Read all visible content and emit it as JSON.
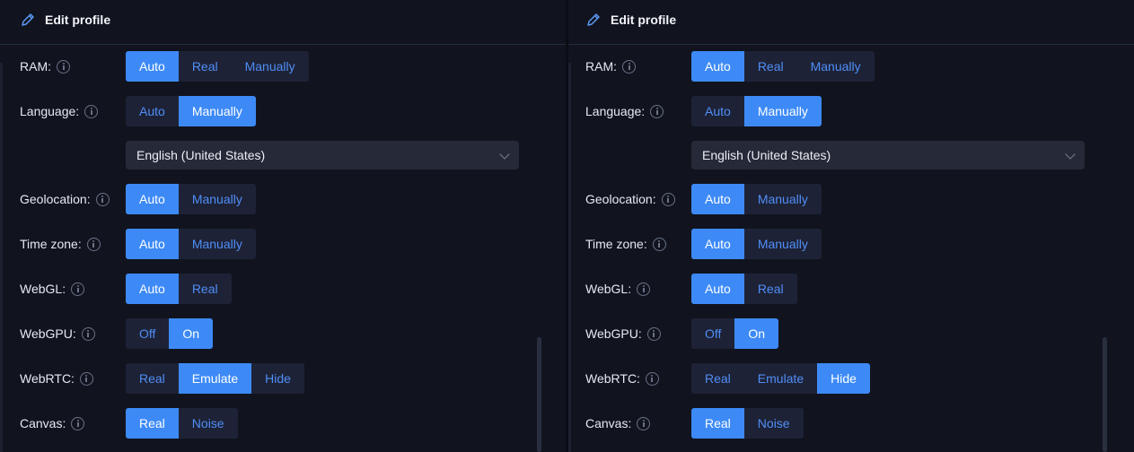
{
  "left": {
    "header": {
      "title": "Edit profile"
    },
    "rows": {
      "ram": {
        "label": "RAM:",
        "options": [
          "Auto",
          "Real",
          "Manually"
        ],
        "selected": "Auto"
      },
      "language": {
        "label": "Language:",
        "options": [
          "Auto",
          "Manually"
        ],
        "selected": "Manually",
        "dropdown_value": "English (United States)"
      },
      "geolocation": {
        "label": "Geolocation:",
        "options": [
          "Auto",
          "Manually"
        ],
        "selected": "Auto"
      },
      "timezone": {
        "label": "Time zone:",
        "options": [
          "Auto",
          "Manually"
        ],
        "selected": "Auto"
      },
      "webgl": {
        "label": "WebGL:",
        "options": [
          "Auto",
          "Real"
        ],
        "selected": "Auto"
      },
      "webgpu": {
        "label": "WebGPU:",
        "options": [
          "Off",
          "On"
        ],
        "selected": "On"
      },
      "webrtc": {
        "label": "WebRTC:",
        "options": [
          "Real",
          "Emulate",
          "Hide"
        ],
        "selected": "Emulate"
      },
      "canvas": {
        "label": "Canvas:",
        "options": [
          "Real",
          "Noise"
        ],
        "selected": "Real"
      }
    }
  },
  "right": {
    "header": {
      "title": "Edit profile"
    },
    "rows": {
      "ram": {
        "label": "RAM:",
        "options": [
          "Auto",
          "Real",
          "Manually"
        ],
        "selected": "Auto"
      },
      "language": {
        "label": "Language:",
        "options": [
          "Auto",
          "Manually"
        ],
        "selected": "Manually",
        "dropdown_value": "English (United States)"
      },
      "geolocation": {
        "label": "Geolocation:",
        "options": [
          "Auto",
          "Manually"
        ],
        "selected": "Auto"
      },
      "timezone": {
        "label": "Time zone:",
        "options": [
          "Auto",
          "Manually"
        ],
        "selected": "Auto"
      },
      "webgl": {
        "label": "WebGL:",
        "options": [
          "Auto",
          "Real"
        ],
        "selected": "Auto"
      },
      "webgpu": {
        "label": "WebGPU:",
        "options": [
          "Off",
          "On"
        ],
        "selected": "On"
      },
      "webrtc": {
        "label": "WebRTC:",
        "options": [
          "Real",
          "Emulate",
          "Hide"
        ],
        "selected": "Hide"
      },
      "canvas": {
        "label": "Canvas:",
        "options": [
          "Real",
          "Noise"
        ],
        "selected": "Real"
      }
    }
  },
  "colors": {
    "background": "#11141f",
    "segment_bg": "#1e2236",
    "accent": "#3d8af7",
    "inactive_text": "#4f8ef7",
    "dropdown_bg": "#262a38"
  },
  "icons": {
    "header": "pencil-icon",
    "info": "info-icon",
    "dropdown": "chevron-down-icon"
  }
}
